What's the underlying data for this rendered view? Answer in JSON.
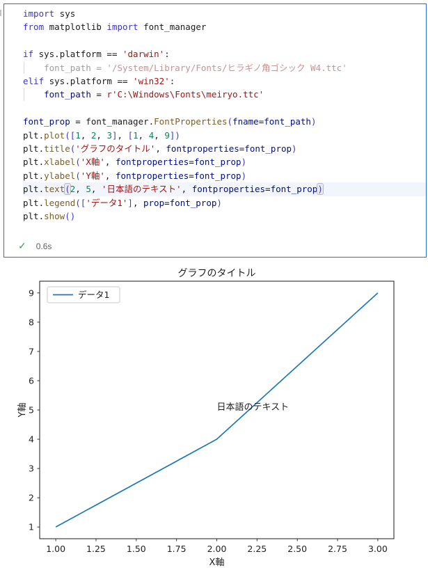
{
  "notebook_cell": {
    "execution": {
      "status_icon": "check",
      "time": "0.6s"
    },
    "code": {
      "lines": [
        {
          "t": [
            [
              "kw",
              "import"
            ],
            [
              "pl",
              " sys"
            ]
          ]
        },
        {
          "t": [
            [
              "kw",
              "from"
            ],
            [
              "pl",
              " matplotlib "
            ],
            [
              "kw",
              "import"
            ],
            [
              "pl",
              " font_manager"
            ]
          ]
        },
        {
          "t": []
        },
        {
          "t": [
            [
              "kw",
              "if"
            ],
            [
              "pl",
              " sys.platform == "
            ],
            [
              "str",
              "'darwin'"
            ],
            [
              "pl",
              ":"
            ]
          ]
        },
        {
          "guide": true,
          "t": [
            [
              "dim",
              "    font_path = "
            ],
            [
              "dimstr",
              "'/System/Library/Fonts/ヒラギノ角ゴシック W4.ttc'"
            ]
          ]
        },
        {
          "t": [
            [
              "kw",
              "elif"
            ],
            [
              "pl",
              " sys.platform == "
            ],
            [
              "str",
              "'win32'"
            ],
            [
              "pl",
              ":"
            ]
          ]
        },
        {
          "guide": true,
          "t": [
            [
              "pl",
              "    "
            ],
            [
              "var",
              "font_path"
            ],
            [
              "pl",
              " = "
            ],
            [
              "str",
              "r'C:\\Windows\\Fonts\\meiryo.ttc'"
            ]
          ]
        },
        {
          "t": []
        },
        {
          "t": [
            [
              "var",
              "font_prop"
            ],
            [
              "pl",
              " = font_manager."
            ],
            [
              "fn",
              "FontProperties"
            ],
            [
              "br",
              "("
            ],
            [
              "var",
              "fname"
            ],
            [
              "pl",
              "="
            ],
            [
              "var",
              "font_path"
            ],
            [
              "br",
              ")"
            ]
          ]
        },
        {
          "t": [
            [
              "pl",
              "plt."
            ],
            [
              "fn",
              "plot"
            ],
            [
              "br",
              "(["
            ],
            [
              "num",
              "1"
            ],
            [
              "pl",
              ", "
            ],
            [
              "num",
              "2"
            ],
            [
              "pl",
              ", "
            ],
            [
              "num",
              "3"
            ],
            [
              "br",
              "]"
            ],
            [
              "pl",
              ", "
            ],
            [
              "br",
              "["
            ],
            [
              "num",
              "1"
            ],
            [
              "pl",
              ", "
            ],
            [
              "num",
              "4"
            ],
            [
              "pl",
              ", "
            ],
            [
              "num",
              "9"
            ],
            [
              "br",
              "])"
            ]
          ]
        },
        {
          "t": [
            [
              "pl",
              "plt."
            ],
            [
              "fn",
              "title"
            ],
            [
              "br",
              "("
            ],
            [
              "str",
              "'グラフのタイトル'"
            ],
            [
              "pl",
              ", "
            ],
            [
              "var",
              "fontproperties"
            ],
            [
              "pl",
              "="
            ],
            [
              "var",
              "font_prop"
            ],
            [
              "br",
              ")"
            ]
          ]
        },
        {
          "t": [
            [
              "pl",
              "plt."
            ],
            [
              "fn",
              "xlabel"
            ],
            [
              "br",
              "("
            ],
            [
              "str",
              "'X軸'"
            ],
            [
              "pl",
              ", "
            ],
            [
              "var",
              "fontproperties"
            ],
            [
              "pl",
              "="
            ],
            [
              "var",
              "font_prop"
            ],
            [
              "br",
              ")"
            ]
          ]
        },
        {
          "t": [
            [
              "pl",
              "plt."
            ],
            [
              "fn",
              "ylabel"
            ],
            [
              "br",
              "("
            ],
            [
              "str",
              "'Y軸'"
            ],
            [
              "pl",
              ", "
            ],
            [
              "var",
              "fontproperties"
            ],
            [
              "pl",
              "="
            ],
            [
              "var",
              "font_prop"
            ],
            [
              "br",
              ")"
            ]
          ]
        },
        {
          "cls": "current",
          "t": [
            [
              "pl",
              "plt."
            ],
            [
              "fn",
              "text"
            ],
            [
              "brhl",
              "("
            ],
            [
              "num",
              "2"
            ],
            [
              "pl",
              ", "
            ],
            [
              "num",
              "5"
            ],
            [
              "pl",
              ", "
            ],
            [
              "str",
              "'日本語のテキスト'"
            ],
            [
              "pl",
              ", "
            ],
            [
              "var",
              "fontproperties"
            ],
            [
              "pl",
              "="
            ],
            [
              "var",
              "font_prop"
            ],
            [
              "brhl",
              ")"
            ]
          ]
        },
        {
          "t": [
            [
              "pl",
              "plt."
            ],
            [
              "fn",
              "legend"
            ],
            [
              "br",
              "(["
            ],
            [
              "str",
              "'データ1'"
            ],
            [
              "br",
              "]"
            ],
            [
              "pl",
              ", "
            ],
            [
              "var",
              "prop"
            ],
            [
              "pl",
              "="
            ],
            [
              "var",
              "font_prop"
            ],
            [
              "br",
              ")"
            ]
          ]
        },
        {
          "t": [
            [
              "pl",
              "plt."
            ],
            [
              "fn",
              "show"
            ],
            [
              "br",
              "()"
            ]
          ]
        }
      ]
    }
  },
  "chart_data": {
    "type": "line",
    "title": "グラフのタイトル",
    "xlabel": "X軸",
    "ylabel": "Y軸",
    "x": [
      1,
      2,
      3
    ],
    "series": [
      {
        "name": "データ1",
        "values": [
          1,
          4,
          9
        ]
      }
    ],
    "xlim": [
      0.9,
      3.1
    ],
    "ylim": [
      0.6,
      9.4
    ],
    "xticks": [
      1.0,
      1.25,
      1.5,
      1.75,
      2.0,
      2.25,
      2.5,
      2.75,
      3.0
    ],
    "yticks": [
      1,
      2,
      3,
      4,
      5,
      6,
      7,
      8,
      9
    ],
    "grid": false,
    "legend_position": "upper left",
    "line_color": "#1f77b4",
    "annotation": {
      "x": 2,
      "y": 5,
      "text": "日本語のテキスト"
    },
    "check_glyph": "✓"
  }
}
